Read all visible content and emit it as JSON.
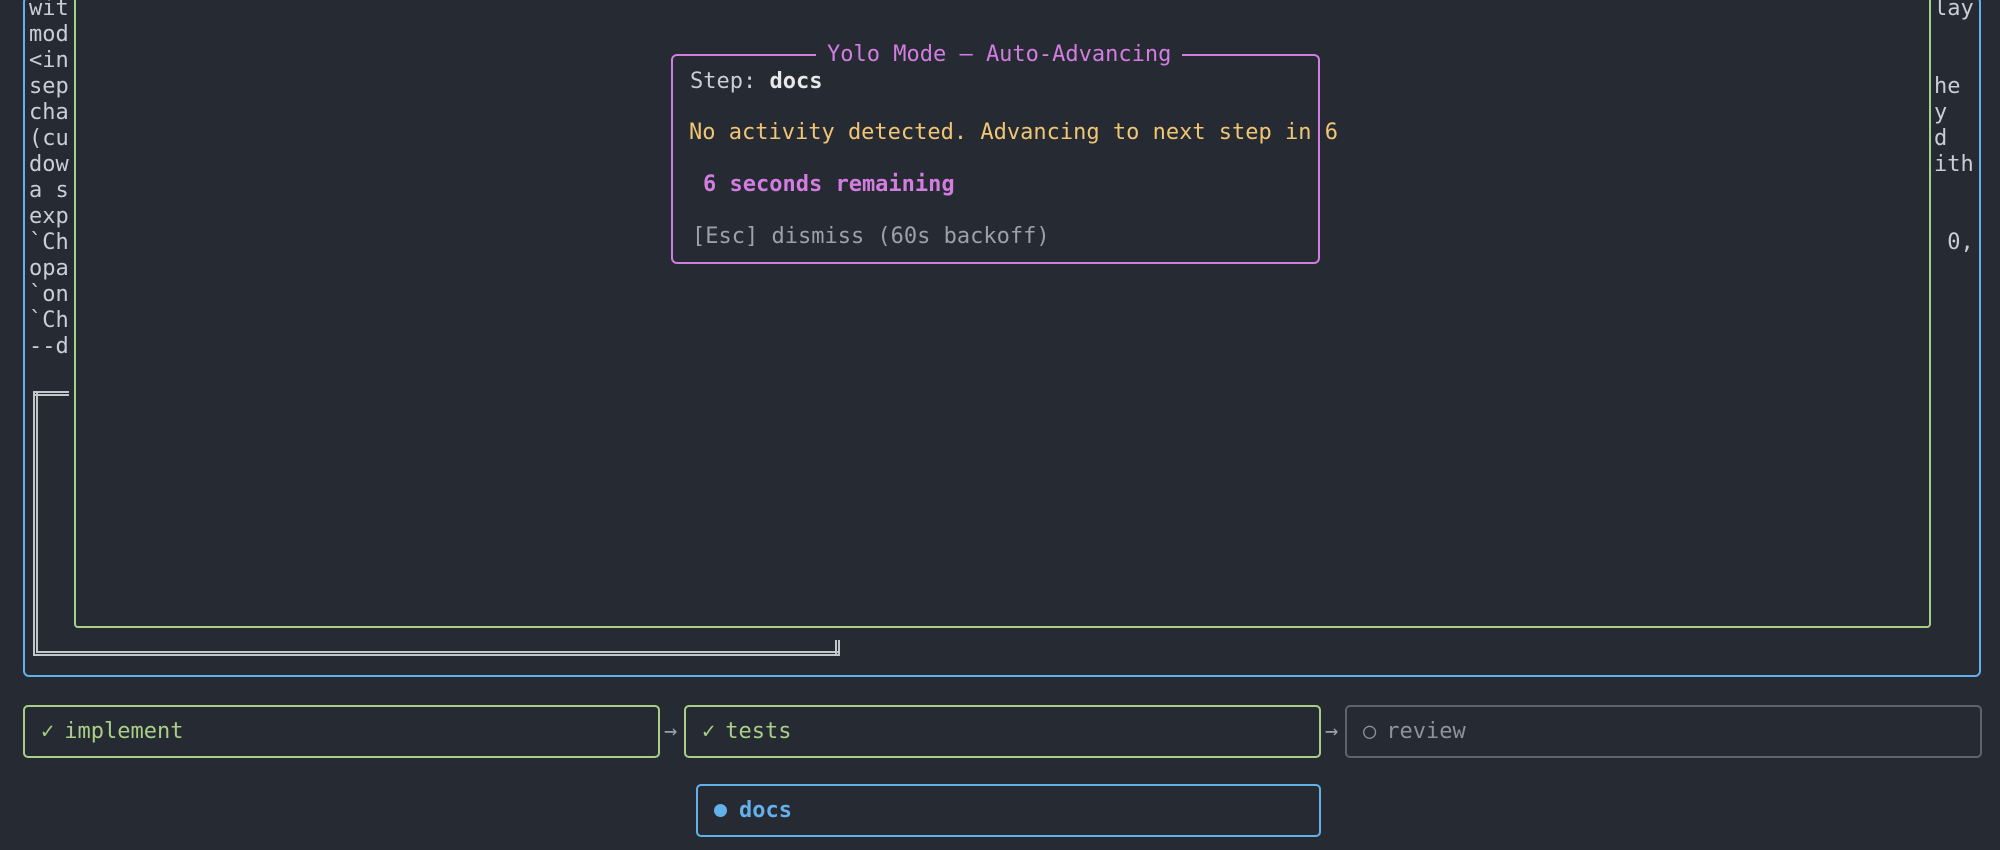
{
  "background_text": {
    "left_fragments": [
      "wit",
      "mod",
      "<in",
      "sep",
      "cha",
      "(cu",
      "dow",
      "a s",
      "exp",
      "`Ch",
      "opa",
      "`on",
      "`Ch",
      "--d"
    ],
    "right_fragments": [
      "lay",
      "",
      "",
      "he",
      "y",
      "d",
      "ith",
      "",
      "",
      " 0,",
      "",
      "",
      "",
      ""
    ]
  },
  "popup": {
    "title": "Yolo Mode — Auto-Advancing",
    "step_label": "Step: ",
    "step_value": "docs",
    "activity_message": "No activity detected. Advancing to next step in 6",
    "countdown": "6 seconds remaining",
    "dismiss_hint": "[Esc] dismiss (60s backoff)"
  },
  "pipeline": {
    "steps": [
      {
        "label": "implement",
        "status": "done",
        "icon": "✓"
      },
      {
        "label": "tests",
        "status": "done",
        "icon": "✓"
      },
      {
        "label": "review",
        "status": "pending",
        "icon": "○"
      },
      {
        "label": "docs",
        "status": "active",
        "icon": "●"
      }
    ],
    "arrow": "→"
  },
  "colors": {
    "background": "#262a33",
    "accent_blue": "#64b0ea",
    "accent_green": "#a9cf86",
    "accent_magenta": "#d27de0",
    "warning_yellow": "#f0c674"
  }
}
